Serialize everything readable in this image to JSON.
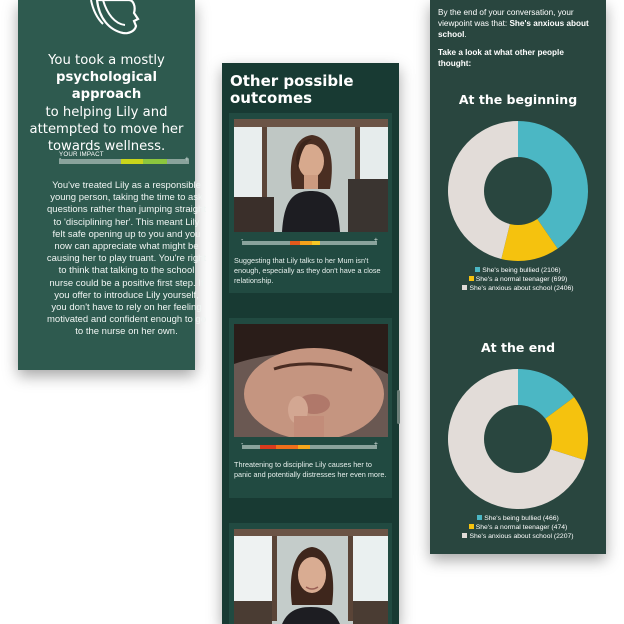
{
  "left_card": {
    "summary_pre": "You took a mostly",
    "summary_bold": "psychological approach",
    "summary_post": "to helping Lily and attempted to move her towards wellness.",
    "impact_label": "YOUR IMPACT",
    "impact_min": "-",
    "impact_max": "+",
    "body": "You've treated Lily as a responsible young person, taking the time to ask questions rather than jumping straight to 'disciplining her'. This meant Lily felt safe opening up to you and you now can appreciate what might be causing her to play truant. You're right to think that talking to the school nurse could be a positive first step. If you offer to introduce Lily yourself, you don't have to rely on her feeling motivated and confident enough to go to the nurse on her own."
  },
  "middle_card": {
    "title": "Other possible outcomes",
    "outcomes": [
      {
        "caption": "Suggesting that Lily talks to her Mum isn't enough, especially as they don't have a close relationship.",
        "minus": "-",
        "plus": "+",
        "colors": [
          "#e25a1c",
          "#f5a21b",
          "#f7c726"
        ]
      },
      {
        "caption": "Threatening to discipline Lily causes her to panic and potentially distresses her even more.",
        "minus": "-",
        "plus": "+",
        "colors": [
          "#d93b1d",
          "#ef6f1b",
          "#f6a71d"
        ]
      },
      {
        "caption": "",
        "minus": "-",
        "plus": "+",
        "colors": []
      }
    ]
  },
  "right_card": {
    "intro_pre": "By the end of your conversation, your viewpoint was that:",
    "intro_bold": "She's anxious about school",
    "intro_post": ".",
    "ask": "Take a look at what other people thought:",
    "charts": [
      {
        "title": "At the beginning",
        "legend": [
          "She's being bullied (2106)",
          "She's a normal teenager (699)",
          "She's anxious about school (2406)"
        ]
      },
      {
        "title": "At the end",
        "legend": [
          "She's being bullied (466)",
          "She's a normal teenager (474)",
          "She's anxious about school (2207)"
        ]
      }
    ]
  },
  "colors": {
    "bullied": "#4bb7c4",
    "teenager": "#f5c20e",
    "anxious": "#e2dcd8",
    "donut_hole": "#29463f"
  },
  "chart_data": [
    {
      "type": "pie",
      "title": "At the beginning",
      "categories": [
        "She's being bullied",
        "She's a normal teenager",
        "She's anxious about school"
      ],
      "values": [
        2106,
        699,
        2406
      ]
    },
    {
      "type": "pie",
      "title": "At the end",
      "categories": [
        "She's being bullied",
        "She's a normal teenager",
        "She's anxious about school"
      ],
      "values": [
        466,
        474,
        2207
      ]
    }
  ]
}
